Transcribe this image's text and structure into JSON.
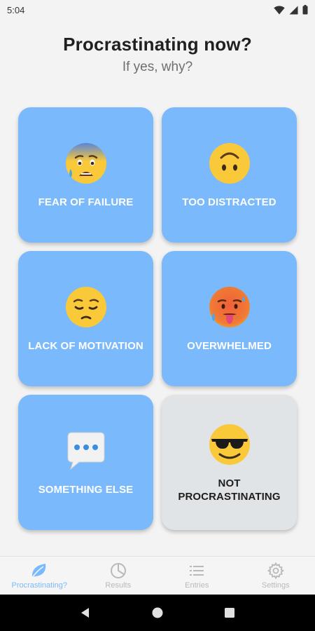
{
  "status_bar": {
    "time": "5:04"
  },
  "header": {
    "title": "Procrastinating now?",
    "subtitle": "If yes, why?"
  },
  "options": [
    {
      "label": "FEAR OF FAILURE",
      "icon": "anxious-sweat-face-icon",
      "color": "#79b9fc"
    },
    {
      "label": "TOO DISTRACTED",
      "icon": "upside-down-face-icon",
      "color": "#79b9fc"
    },
    {
      "label": "LACK OF MOTIVATION",
      "icon": "pensive-face-icon",
      "color": "#79b9fc"
    },
    {
      "label": "OVERWHELMED",
      "icon": "hot-face-icon",
      "color": "#79b9fc"
    },
    {
      "label": "SOMETHING ELSE",
      "icon": "speech-bubble-icon",
      "color": "#79b9fc"
    },
    {
      "label": "NOT PROCRASTINATING",
      "icon": "sunglasses-face-icon",
      "color": "#e1e4e7"
    }
  ],
  "bottom_nav": [
    {
      "label": "Procrastinating?",
      "icon": "leaf-icon",
      "active": true
    },
    {
      "label": "Results",
      "icon": "pie-chart-icon",
      "active": false
    },
    {
      "label": "Entries",
      "icon": "list-icon",
      "active": false
    },
    {
      "label": "Settings",
      "icon": "gear-icon",
      "active": false
    }
  ],
  "colors": {
    "accent": "#79b9fc",
    "neutral_card": "#e1e4e7",
    "background": "#f3f3f3"
  }
}
